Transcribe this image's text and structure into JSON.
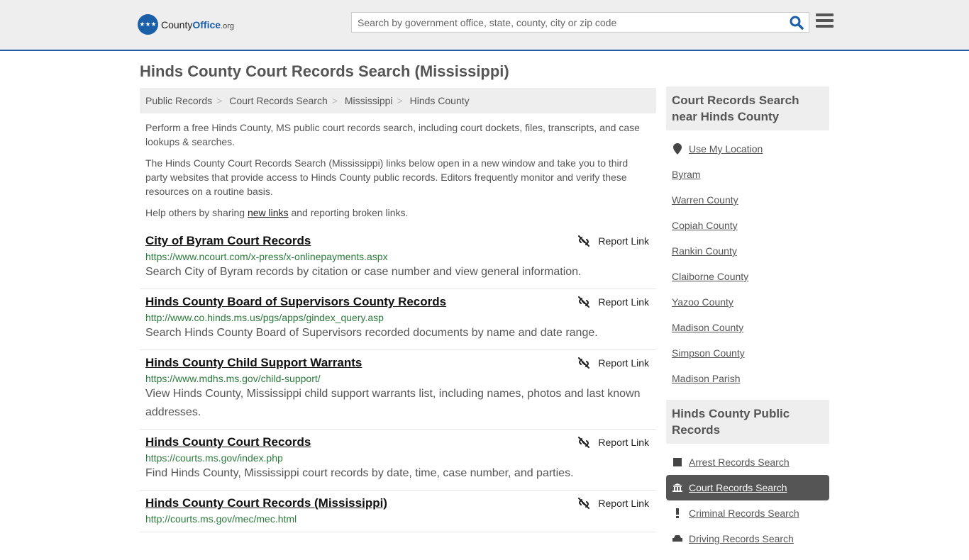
{
  "header": {
    "logo": {
      "name": "County",
      "accent": "Office",
      "tld": ".org"
    },
    "search_placeholder": "Search by government office, state, county, city or zip code"
  },
  "page_title": "Hinds County Court Records Search (Mississippi)",
  "breadcrumb": [
    "Public Records",
    "Court Records Search",
    "Mississippi",
    "Hinds County"
  ],
  "intro": {
    "p1": "Perform a free Hinds County, MS public court records search, including court dockets, files, transcripts, and case lookups & searches.",
    "p2": "The Hinds County Court Records Search (Mississippi) links below open in a new window and take you to third party websites that provide access to Hinds County public records. Editors frequently monitor and verify these resources on a routine basis.",
    "p3_before": "Help others by sharing ",
    "p3_link": "new links",
    "p3_after": " and reporting broken links."
  },
  "report_label": "Report Link",
  "links": [
    {
      "title": "City of Byram Court Records",
      "url": "https://www.ncourt.com/x-press/x-onlinepayments.aspx",
      "desc": "Search City of Byram records by citation or case number and view general information."
    },
    {
      "title": "Hinds County Board of Supervisors County Records",
      "url": "http://www.co.hinds.ms.us/pgs/apps/gindex_query.asp",
      "desc": "Search Hinds County Board of Supervisors recorded documents by name and date range."
    },
    {
      "title": "Hinds County Child Support Warrants",
      "url": "https://www.mdhs.ms.gov/child-support/",
      "desc": "View Hinds County, Mississippi child support warrants list, including names, photos and last known addresses."
    },
    {
      "title": "Hinds County Court Records",
      "url": "https://courts.ms.gov/index.php",
      "desc": "Find Hinds County, Mississippi court records by date, time, case number, and parties."
    },
    {
      "title": "Hinds County Court Records (Mississippi)",
      "url": "http://courts.ms.gov/mec/mec.html",
      "desc": ""
    }
  ],
  "sidebar": {
    "nearby_title": "Court Records Search near Hinds County",
    "use_location": "Use My Location",
    "nearby": [
      "Byram",
      "Warren County",
      "Copiah County",
      "Rankin County",
      "Claiborne County",
      "Yazoo County",
      "Madison County",
      "Simpson County",
      "Madison Parish"
    ],
    "public_title": "Hinds County Public Records",
    "public": [
      {
        "label": "Arrest Records Search",
        "icon": "square-icon"
      },
      {
        "label": "Court Records Search",
        "icon": "courthouse-icon",
        "active": true
      },
      {
        "label": "Criminal Records Search",
        "icon": "exclamation-icon"
      },
      {
        "label": "Driving Records Search",
        "icon": "car-icon"
      }
    ]
  },
  "colors": {
    "brand": "#1b5fa8",
    "url_green": "#2a7a3b",
    "active_bg": "#555555"
  }
}
